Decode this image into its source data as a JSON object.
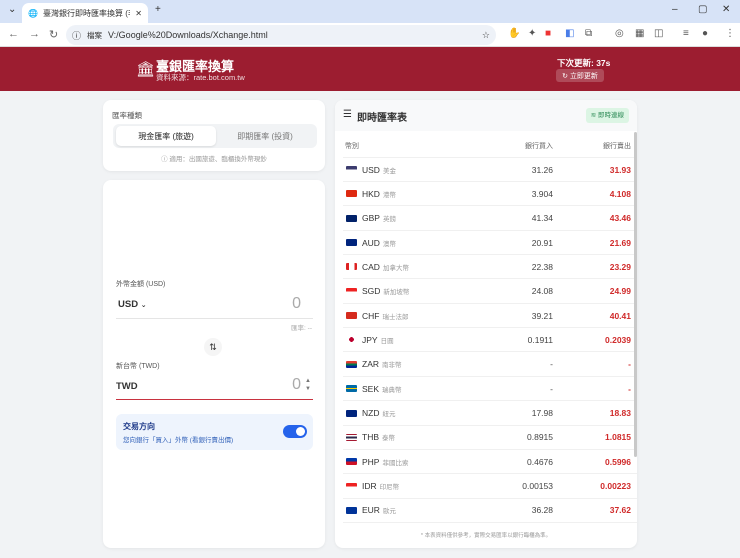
{
  "browser": {
    "tab_title": "臺灣銀行即時匯率換算 (非官方)",
    "url_label": "檔案",
    "url": "V:/Google%20Downloads/Xchange.html"
  },
  "header": {
    "title": "臺銀匯率換算",
    "source": "資料來源：rate.bot.com.tw",
    "next_update": "下次更新: 37s",
    "refresh_label": "立即更新"
  },
  "rate_type": {
    "label": "匯率種類",
    "options": [
      "現金匯率 (旅遊)",
      "即期匯率 (投資)"
    ],
    "selected": 0,
    "hint": "適用：出國旅遊、臨櫃換外幣現鈔"
  },
  "converter": {
    "foreign_label": "外幣金額 (USD)",
    "foreign_currency": "USD",
    "foreign_value": "0",
    "rate_note": "匯率: --",
    "twd_label": "新台幣 (TWD)",
    "twd_currency": "TWD",
    "twd_value": "0",
    "direction_title": "交易方向",
    "direction_desc": "您向銀行「買入」外幣 (看銀行賣出價)",
    "direction_on": true
  },
  "table": {
    "title": "即時匯率表",
    "status": "即時連線",
    "headers": [
      "幣別",
      "銀行買入",
      "銀行賣出"
    ],
    "rows": [
      {
        "code": "USD",
        "name": "美金",
        "buy": "31.26",
        "sell": "31.93"
      },
      {
        "code": "HKD",
        "name": "港幣",
        "buy": "3.904",
        "sell": "4.108"
      },
      {
        "code": "GBP",
        "name": "英鎊",
        "buy": "41.34",
        "sell": "43.46"
      },
      {
        "code": "AUD",
        "name": "澳幣",
        "buy": "20.91",
        "sell": "21.69"
      },
      {
        "code": "CAD",
        "name": "加拿大幣",
        "buy": "22.38",
        "sell": "23.29"
      },
      {
        "code": "SGD",
        "name": "新加坡幣",
        "buy": "24.08",
        "sell": "24.99"
      },
      {
        "code": "CHF",
        "name": "瑞士法郎",
        "buy": "39.21",
        "sell": "40.41"
      },
      {
        "code": "JPY",
        "name": "日圓",
        "buy": "0.1911",
        "sell": "0.2039"
      },
      {
        "code": "ZAR",
        "name": "南非幣",
        "buy": "-",
        "sell": "-"
      },
      {
        "code": "SEK",
        "name": "瑞典幣",
        "buy": "-",
        "sell": "-"
      },
      {
        "code": "NZD",
        "name": "紐元",
        "buy": "17.98",
        "sell": "18.83"
      },
      {
        "code": "THB",
        "name": "泰幣",
        "buy": "0.8915",
        "sell": "1.0815"
      },
      {
        "code": "PHP",
        "name": "菲國比索",
        "buy": "0.4676",
        "sell": "0.5996"
      },
      {
        "code": "IDR",
        "name": "印尼幣",
        "buy": "0.00153",
        "sell": "0.00223"
      },
      {
        "code": "EUR",
        "name": "歐元",
        "buy": "36.28",
        "sell": "37.62"
      }
    ],
    "footnote": "* 本表資料僅供參考，實際交易匯率以銀行臨櫃為準。"
  },
  "colors": {
    "brand": "#9c1d30",
    "sell": "#d02a2a",
    "toggle": "#2563eb"
  }
}
